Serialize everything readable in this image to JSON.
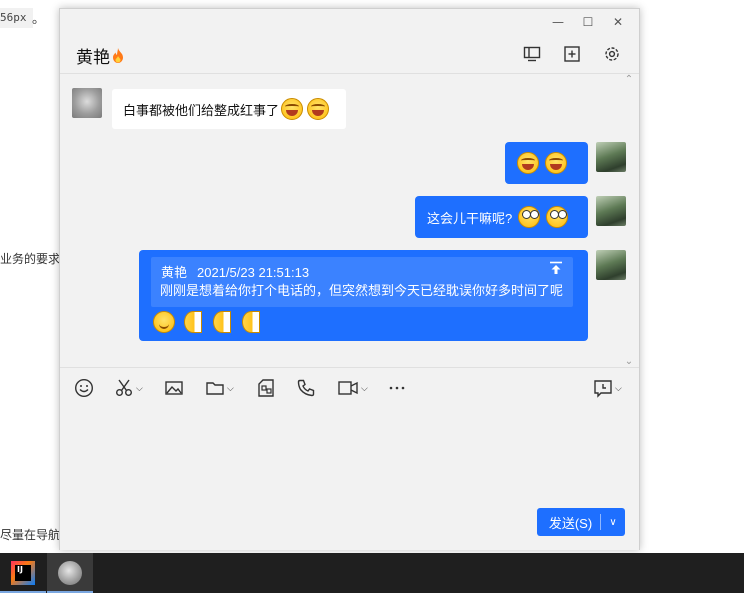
{
  "background": {
    "code_snippet": "56px",
    "code_suffix": "。",
    "text_line_1": "业务的要求",
    "text_line_2": "尽量在导航"
  },
  "taskbar": {
    "apps": [
      {
        "name": "IntelliJ IDEA",
        "icon": "intellij-icon",
        "label": "IJ"
      },
      {
        "name": "QQ",
        "icon": "qq-avatar-icon"
      }
    ]
  },
  "window": {
    "controls": {
      "minimize": "—",
      "maximize": "☐",
      "close": "✕"
    },
    "title": "黄艳",
    "title_badge": "fire-icon",
    "header_icons": [
      "screen-share-icon",
      "add-member-icon",
      "settings-icon"
    ]
  },
  "messages": [
    {
      "side": "left",
      "text": "白事都被他们给整成红事了",
      "emojis": [
        "laugh-cry",
        "laugh-cry"
      ]
    },
    {
      "side": "right",
      "text": "",
      "emojis": [
        "laugh-cry",
        "laugh-cry"
      ]
    },
    {
      "side": "right",
      "text": "这会儿干嘛呢?",
      "emojis": [
        "shocked",
        "shocked"
      ]
    },
    {
      "side": "right",
      "quote": {
        "sender": "黄艳",
        "time": "2021/5/23 21:51:13",
        "text": "刚刚是想着给你打个电话的，但突然想到今天已经耽误你好多时间了呢"
      },
      "emojis": [
        "smirk",
        "half-face",
        "half-face",
        "half-face"
      ]
    }
  ],
  "toolbar": {
    "tools": [
      "emoji-icon",
      "scissors-icon",
      "image-icon",
      "folder-icon",
      "red-packet-icon",
      "phone-icon",
      "video-icon",
      "more-icon",
      "history-icon"
    ]
  },
  "send_button": {
    "label": "发送(S)"
  },
  "colors": {
    "accent": "#1e6fff",
    "quote_bg": "#3b82ff",
    "window_bg": "#f2f2f2"
  }
}
